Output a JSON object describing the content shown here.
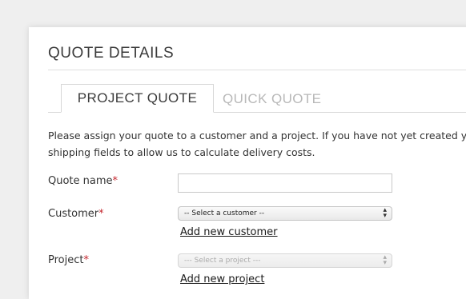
{
  "section": {
    "title": "QUOTE DETAILS"
  },
  "tabs": [
    {
      "label": "PROJECT QUOTE",
      "active": true
    },
    {
      "label": "QUICK QUOTE",
      "active": false
    }
  ],
  "intro": {
    "line1": "Please assign your quote to a customer and a project. If you have not yet created y",
    "line2": "shipping fields to allow us to calculate delivery costs."
  },
  "form": {
    "quote_name": {
      "label": "Quote name",
      "required_mark": "*",
      "value": ""
    },
    "customer": {
      "label": "Customer",
      "required_mark": "*",
      "selected": "-- Select a customer --",
      "add_link": "Add new customer"
    },
    "project": {
      "label": "Project",
      "required_mark": "*",
      "selected": "--- Select a project ---",
      "add_link": "Add new project"
    }
  },
  "colors": {
    "required": "#c4262e",
    "inactive_tab": "#b8b8b8",
    "text": "#333333"
  }
}
